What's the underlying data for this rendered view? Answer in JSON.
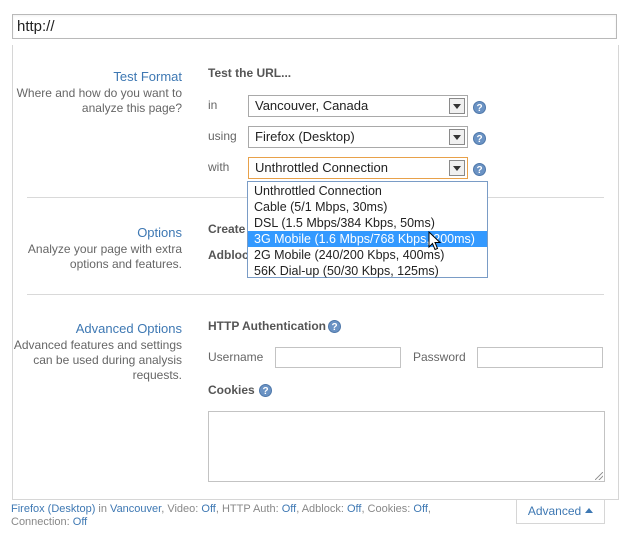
{
  "url_bar": {
    "value": "http://"
  },
  "test_format": {
    "title": "Test Format",
    "desc": "Where and how do you want to analyze this page?",
    "heading": "Test the URL...",
    "in_label": "in",
    "location": "Vancouver, Canada",
    "using_label": "using",
    "browser": "Firefox (Desktop)",
    "with_label": "with",
    "connection": "Unthrottled Connection",
    "connection_options": [
      "Unthrottled Connection",
      "Cable (5/1 Mbps, 30ms)",
      "DSL (1.5 Mbps/384 Kbps, 50ms)",
      "3G Mobile (1.6 Mbps/768 Kbps, 200ms)",
      "2G Mobile (240/200 Kbps, 400ms)",
      "56K Dial-up (50/30 Kbps, 125ms)"
    ],
    "highlighted_option": "3G Mobile (1.6 Mbps/768 Kbps, 200ms)"
  },
  "options": {
    "title": "Options",
    "desc": "Analyze your page with extra options and features.",
    "create_label": "Create",
    "adblock_label": "Adbloc"
  },
  "advanced_options": {
    "title": "Advanced Options",
    "desc": "Advanced features and settings can be used during analysis requests.",
    "http_auth_label": "HTTP Authentication",
    "username_label": "Username",
    "password_label": "Password",
    "username_value": "",
    "password_value": "",
    "cookies_label": "Cookies",
    "cookies_value": ""
  },
  "summary": {
    "browser": "Firefox (Desktop)",
    "in_word": " in ",
    "location": "Vancouver",
    "video_k": ", Video: ",
    "video_v": "Off",
    "auth_k": ", HTTP Auth: ",
    "auth_v": "Off",
    "adblock_k": ", Adblock: ",
    "adblock_v": "Off",
    "cookies_k": ", Cookies: ",
    "cookies_v": "Off",
    "connection_k": ", Connection: ",
    "connection_v": "Off"
  },
  "advanced_tab": {
    "label": "Advanced"
  },
  "help_glyph": "?",
  "colors": {
    "accent": "#3e78b3",
    "highlight": "#3399ff",
    "help": "#6b93c4"
  }
}
